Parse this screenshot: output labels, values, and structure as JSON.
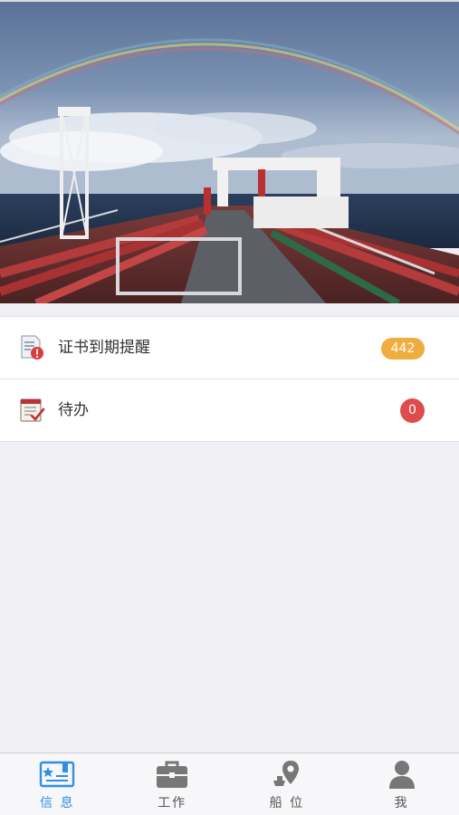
{
  "hero": {
    "image": "tanker-deck-with-rainbow"
  },
  "list": {
    "items": [
      {
        "label": "证书到期提醒",
        "badge": "442",
        "icon": "certificate-warning-icon",
        "badge_color": "#f0ad3f"
      },
      {
        "label": "待办",
        "badge": "0",
        "icon": "todo-notebook-icon",
        "badge_color": "#e04b4b"
      }
    ]
  },
  "tabbar": {
    "tabs": [
      {
        "label": "信 息",
        "icon": "message-card-icon",
        "active": true
      },
      {
        "label": "工作",
        "icon": "briefcase-icon",
        "active": false
      },
      {
        "label": "船 位",
        "icon": "ship-location-icon",
        "active": false
      },
      {
        "label": "我",
        "icon": "person-icon",
        "active": false
      }
    ],
    "active_color": "#2f8ee5"
  }
}
